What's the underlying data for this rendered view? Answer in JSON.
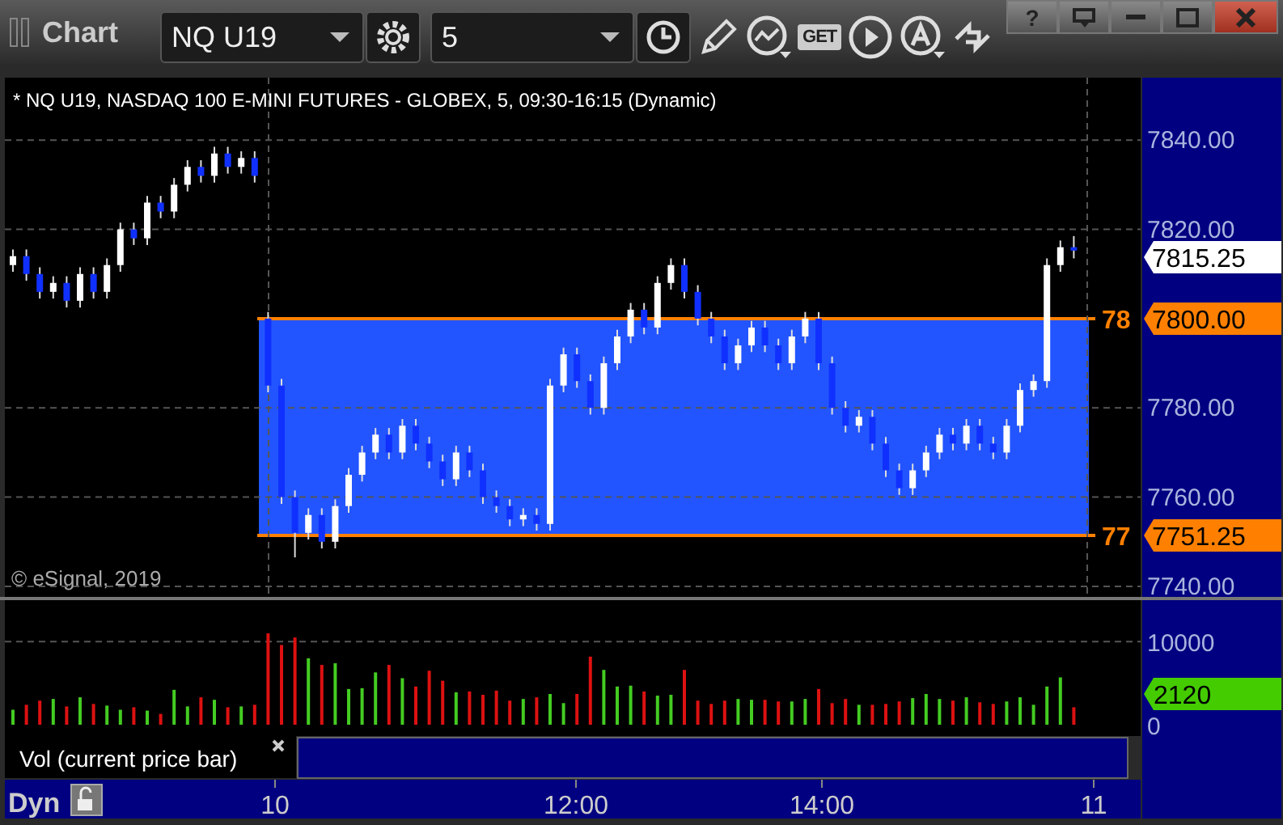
{
  "window": {
    "title": "Chart",
    "help_glyph": "?"
  },
  "toolbar": {
    "symbol": "NQ U19",
    "interval": "5",
    "get_label": "GET"
  },
  "chart": {
    "header": "* NQ U19, NASDAQ 100 E-MINI FUTURES - GLOBEX, 5, 09:30-16:15 (Dynamic)",
    "copyright": "© eSignal, 2019",
    "last_price": "7815.25",
    "zone": {
      "upper_label": "78",
      "upper_price": "7800.00",
      "lower_label": "77",
      "lower_price": "7751.25"
    },
    "chart_data": {
      "type": "candlestick",
      "ohlc": [
        [
          7812,
          7815.5,
          7810.5,
          7814
        ],
        [
          7814,
          7815.5,
          7808.5,
          7810
        ],
        [
          7810,
          7811.5,
          7804.5,
          7806
        ],
        [
          7806,
          7809.5,
          7804.5,
          7808
        ],
        [
          7808,
          7809.5,
          7802.5,
          7804
        ],
        [
          7804,
          7811.5,
          7802.5,
          7810
        ],
        [
          7810,
          7811.5,
          7804.5,
          7806
        ],
        [
          7806,
          7813.5,
          7804.5,
          7812
        ],
        [
          7812,
          7821.5,
          7810.5,
          7820
        ],
        [
          7820,
          7821.5,
          7816.5,
          7818
        ],
        [
          7818,
          7827.5,
          7816.5,
          7826
        ],
        [
          7826,
          7827.5,
          7822.5,
          7824
        ],
        [
          7824,
          7831.5,
          7822.5,
          7830
        ],
        [
          7830,
          7835.5,
          7828.5,
          7834
        ],
        [
          7834,
          7835.5,
          7830.5,
          7832
        ],
        [
          7832,
          7838.5,
          7830.5,
          7837
        ],
        [
          7837,
          7838.5,
          7832.5,
          7834
        ],
        [
          7834,
          7837.5,
          7832.5,
          7836
        ],
        [
          7836,
          7837.5,
          7830.5,
          7832
        ],
        [
          7800,
          7801.5,
          7783.5,
          7785
        ],
        [
          7785,
          7786.5,
          7758.5,
          7760
        ],
        [
          7760,
          7761.5,
          7746.5,
          7752
        ],
        [
          7752,
          7757.5,
          7750.5,
          7756
        ],
        [
          7756,
          7757.5,
          7748.5,
          7750
        ],
        [
          7750,
          7759.5,
          7748.5,
          7758
        ],
        [
          7758,
          7766.5,
          7756.5,
          7765
        ],
        [
          7765,
          7771.5,
          7763.5,
          7770
        ],
        [
          7770,
          7775.5,
          7768.5,
          7774
        ],
        [
          7774,
          7775.5,
          7768.5,
          7770
        ],
        [
          7770,
          7777.5,
          7768.5,
          7776
        ],
        [
          7776,
          7777.5,
          7770.5,
          7772
        ],
        [
          7772,
          7773.5,
          7766.5,
          7768
        ],
        [
          7768,
          7769.5,
          7762.5,
          7764
        ],
        [
          7764,
          7771.5,
          7762.5,
          7770
        ],
        [
          7770,
          7771.5,
          7764.5,
          7766
        ],
        [
          7766,
          7767.5,
          7758.5,
          7760
        ],
        [
          7760,
          7761.5,
          7756.5,
          7758
        ],
        [
          7758,
          7759.5,
          7753.5,
          7755
        ],
        [
          7755,
          7757.5,
          7753.5,
          7756
        ],
        [
          7756,
          7757.5,
          7752.5,
          7754
        ],
        [
          7754,
          7786.5,
          7752.5,
          7785
        ],
        [
          7785,
          7793.5,
          7783.5,
          7792
        ],
        [
          7792,
          7793.5,
          7784.5,
          7786
        ],
        [
          7786,
          7787.5,
          7778.5,
          7780
        ],
        [
          7780,
          7791.5,
          7778.5,
          7790
        ],
        [
          7790,
          7797.5,
          7788.5,
          7796
        ],
        [
          7796,
          7803.5,
          7794.5,
          7802
        ],
        [
          7802,
          7803.5,
          7796.5,
          7798
        ],
        [
          7798,
          7809.5,
          7796.5,
          7808
        ],
        [
          7808,
          7813.5,
          7806.5,
          7812
        ],
        [
          7812,
          7813.5,
          7804.5,
          7806
        ],
        [
          7806,
          7807.5,
          7798.5,
          7800
        ],
        [
          7800,
          7801.5,
          7794.5,
          7796
        ],
        [
          7796,
          7797.5,
          7788.5,
          7790
        ],
        [
          7790,
          7795.5,
          7788.5,
          7794
        ],
        [
          7794,
          7799.5,
          7792.5,
          7798
        ],
        [
          7798,
          7799.5,
          7792.5,
          7794
        ],
        [
          7794,
          7795.5,
          7788.5,
          7790
        ],
        [
          7790,
          7797.5,
          7788.5,
          7796
        ],
        [
          7796,
          7801.5,
          7794.5,
          7800
        ],
        [
          7800,
          7801.5,
          7788.5,
          7790
        ],
        [
          7790,
          7791.5,
          7778.5,
          7780
        ],
        [
          7780,
          7781.5,
          7774.5,
          7776
        ],
        [
          7776,
          7779.5,
          7774.5,
          7778
        ],
        [
          7778,
          7779.5,
          7770.5,
          7772
        ],
        [
          7772,
          7773.5,
          7764.5,
          7766
        ],
        [
          7766,
          7767.5,
          7760.5,
          7762
        ],
        [
          7762,
          7767.5,
          7760.5,
          7766
        ],
        [
          7766,
          7771.5,
          7764.5,
          7770
        ],
        [
          7770,
          7775.5,
          7768.5,
          7774
        ],
        [
          7774,
          7775.5,
          7770.5,
          7772
        ],
        [
          7772,
          7777.5,
          7770.5,
          7776
        ],
        [
          7776,
          7777.5,
          7770.5,
          7772
        ],
        [
          7772,
          7773.5,
          7768.5,
          7770
        ],
        [
          7770,
          7777.5,
          7768.5,
          7776
        ],
        [
          7776,
          7785.5,
          7774.5,
          7784
        ],
        [
          7784,
          7787.5,
          7782.5,
          7786
        ],
        [
          7786,
          7813.5,
          7784.5,
          7812
        ],
        [
          7812,
          7817.5,
          7810.5,
          7816
        ],
        [
          7816,
          7818.5,
          7813.5,
          7815.25
        ]
      ],
      "ylim": [
        7738,
        7854
      ],
      "yticks": [
        {
          "value": 7840,
          "label": "7840.00"
        },
        {
          "value": 7820,
          "label": "7820.00"
        },
        {
          "value": 7780,
          "label": "7780.00"
        },
        {
          "value": 7760,
          "label": "7760.00"
        },
        {
          "value": 7740,
          "label": "7740.00"
        }
      ],
      "grid": true
    }
  },
  "volume": {
    "current": "2120",
    "chart_data": {
      "type": "bar",
      "title": "Vol (current price bar)",
      "values": [
        1800,
        2400,
        2900,
        3100,
        2200,
        3300,
        2500,
        2300,
        1800,
        2100,
        1700,
        1300,
        4200,
        2200,
        3300,
        3000,
        2100,
        2200,
        2400,
        11000,
        9600,
        10500,
        8000,
        7200,
        7400,
        4300,
        4400,
        6300,
        7200,
        5600,
        4600,
        6500,
        5300,
        3900,
        4000,
        3600,
        4100,
        2900,
        3100,
        3300,
        3700,
        2600,
        3700,
        8200,
        6600,
        4600,
        4700,
        4000,
        3500,
        3600,
        6600,
        2900,
        2500,
        2900,
        3100,
        3000,
        3000,
        2800,
        2800,
        3100,
        4300,
        2600,
        3100,
        2400,
        2400,
        2500,
        2800,
        3200,
        3700,
        3100,
        2900,
        3300,
        2700,
        2500,
        2800,
        3300,
        2400,
        4600,
        5700,
        2100
      ],
      "ylim": [
        0,
        15000
      ],
      "yticks": [
        {
          "value": 10000,
          "label": "10000"
        },
        {
          "value": 0,
          "label": "0"
        }
      ]
    }
  },
  "time_axis": {
    "labels": [
      "10",
      "12:00",
      "14:00",
      "11"
    ]
  },
  "status": {
    "mode": "Dyn"
  }
}
